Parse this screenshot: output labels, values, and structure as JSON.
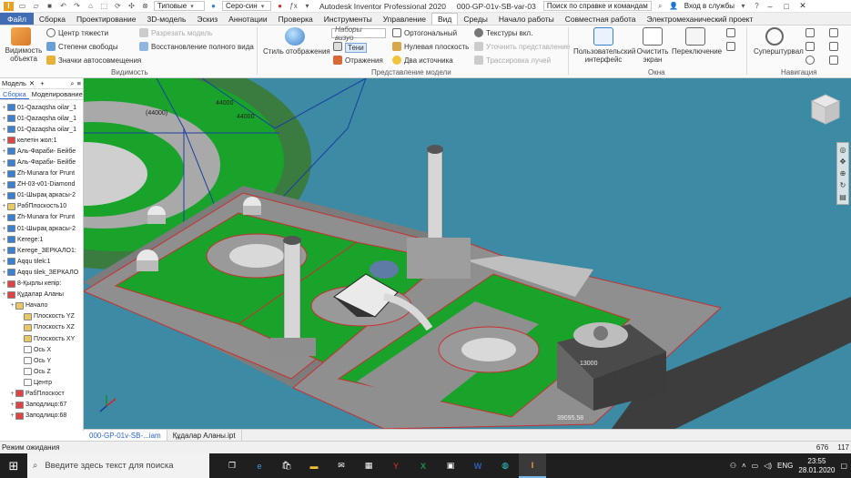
{
  "app": {
    "title": "Autodesk Inventor Professional 2020",
    "doc_title": "000-GP-01v-SB-var-03",
    "help_search": "Поиск по справке и командам",
    "login": "Вход в службы",
    "quick_select_1": "Типовые",
    "quick_select_2": "Серо-син"
  },
  "menu_tabs": [
    {
      "label": "Файл"
    },
    {
      "label": "Сборка"
    },
    {
      "label": "Проектирование"
    },
    {
      "label": "3D-модель"
    },
    {
      "label": "Эскиз"
    },
    {
      "label": "Аннотации"
    },
    {
      "label": "Проверка"
    },
    {
      "label": "Инструменты"
    },
    {
      "label": "Управление"
    },
    {
      "label": "Вид"
    },
    {
      "label": "Среды"
    },
    {
      "label": "Начало работы"
    },
    {
      "label": "Совместная работа"
    },
    {
      "label": "Электромеханический проект"
    }
  ],
  "ribbon": {
    "visibility_object": "Видимость объекта",
    "center_of_gravity": "Центр тяжести",
    "dof": "Степени свободы",
    "autolimit_icons": "Значки автосовмещения",
    "section_model": "Разрезать модель",
    "restore_full_view": "Восстановление полного вида",
    "group_visibility": "Видимость",
    "display_style": "Стиль отображения",
    "visual_sets": "Наборы визуо",
    "shadows": "Тени",
    "reflections": "Отражения",
    "orthographic": "Ортогональный",
    "ground_plane": "Нулевая плоскость",
    "two_sources": "Два источника",
    "textures_on": "Текстуры вкл.",
    "refine_view": "Уточнить представление",
    "ray_tracing": "Трассировка лучей",
    "group_model_view": "Представление модели",
    "user_interface": "Пользовательский интерфейс",
    "clean_screen": "Очистить экран",
    "switch": "Переключение",
    "group_windows": "Окна",
    "full_navigation_wheel": "Суперштурвал",
    "group_navigation": "Навигация"
  },
  "browser": {
    "head_label": "Модель",
    "tab_assembly": "Сборка",
    "tab_modeling": "Моделирование",
    "items": [
      {
        "label": "01-Qazaqsha oilar_1",
        "indent": 0,
        "color": "#3a7fd1"
      },
      {
        "label": "01-Qazaqsha oilar_1",
        "indent": 0,
        "color": "#3a7fd1"
      },
      {
        "label": "01-Qazaqsha oilar_1",
        "indent": 0,
        "color": "#3a7fd1"
      },
      {
        "label": "келетін жол:1",
        "indent": 0,
        "color": "#d44"
      },
      {
        "label": "Аль-Фараби- Бейбе",
        "indent": 0,
        "color": "#3a7fd1"
      },
      {
        "label": "Аль-Фараби- Бейбе",
        "indent": 0,
        "color": "#3a7fd1"
      },
      {
        "label": "Zh-Munara for Prunt",
        "indent": 0,
        "color": "#3a7fd1"
      },
      {
        "label": "ZH-03-v01-Diamond",
        "indent": 0,
        "color": "#3a7fd1"
      },
      {
        "label": "01-Шырақ аркасы-2",
        "indent": 0,
        "color": "#3a7fd1"
      },
      {
        "label": "РабПлоскость10",
        "indent": 0,
        "color": "#e9c866"
      },
      {
        "label": "Zh-Munara for Prunt",
        "indent": 0,
        "color": "#3a7fd1"
      },
      {
        "label": "01-Шырақ аркасы-2",
        "indent": 0,
        "color": "#3a7fd1"
      },
      {
        "label": "Kerege:1",
        "indent": 0,
        "color": "#3a7fd1"
      },
      {
        "label": "Kerege_ЗЕРКАЛО1:",
        "indent": 0,
        "color": "#3a7fd1"
      },
      {
        "label": "Aqqu tilek:1",
        "indent": 0,
        "color": "#3a7fd1"
      },
      {
        "label": "Aqqu tilek_ЗЕРКАЛО",
        "indent": 0,
        "color": "#3a7fd1"
      },
      {
        "label": "8-Қырлы кепір:",
        "indent": 0,
        "color": "#d44"
      },
      {
        "label": "Құдалар Аланы",
        "indent": 0,
        "color": "#d44"
      },
      {
        "label": "Начало",
        "indent": 1,
        "color": "#e9c866"
      },
      {
        "label": "Плоскость YZ",
        "indent": 2,
        "color": "#e9c866"
      },
      {
        "label": "Плоскость XZ",
        "indent": 2,
        "color": "#e9c866"
      },
      {
        "label": "Плоскость XY",
        "indent": 2,
        "color": "#e9c866"
      },
      {
        "label": "Ось X",
        "indent": 2,
        "color": "#fff"
      },
      {
        "label": "Ось Y",
        "indent": 2,
        "color": "#fff"
      },
      {
        "label": "Ось Z",
        "indent": 2,
        "color": "#fff"
      },
      {
        "label": "Центр",
        "indent": 2,
        "color": "#fff"
      },
      {
        "label": "РабПлоскост",
        "indent": 1,
        "color": "#d44"
      },
      {
        "label": "Заподлицо:67",
        "indent": 1,
        "color": "#d44"
      },
      {
        "label": "Заподлицо:68",
        "indent": 1,
        "color": "#d44"
      }
    ]
  },
  "viewport": {
    "dim_44000_a": "44000",
    "dim_44000_b": "44000",
    "dim_44000_c": "(44000)",
    "dim_13000": "13000",
    "dim_39095": "39095.58"
  },
  "doc_tabs": [
    {
      "label": "000-GP-01v-SB-...iam",
      "active": true
    },
    {
      "label": "Құдалар Аланы.ipt",
      "active": false
    }
  ],
  "status": {
    "text": "Режим ожидания",
    "num1": "676",
    "num2": "117"
  },
  "taskbar": {
    "search_placeholder": "Введите здесь текст для поиска",
    "lang": "ENG",
    "time": "23:55",
    "date": "28.01.2020"
  },
  "colors": {
    "viewport_bg": "#3c8aa3",
    "grass": "#19a32b",
    "paving": "#8f8f8f",
    "accent": "#3f6cb3"
  }
}
